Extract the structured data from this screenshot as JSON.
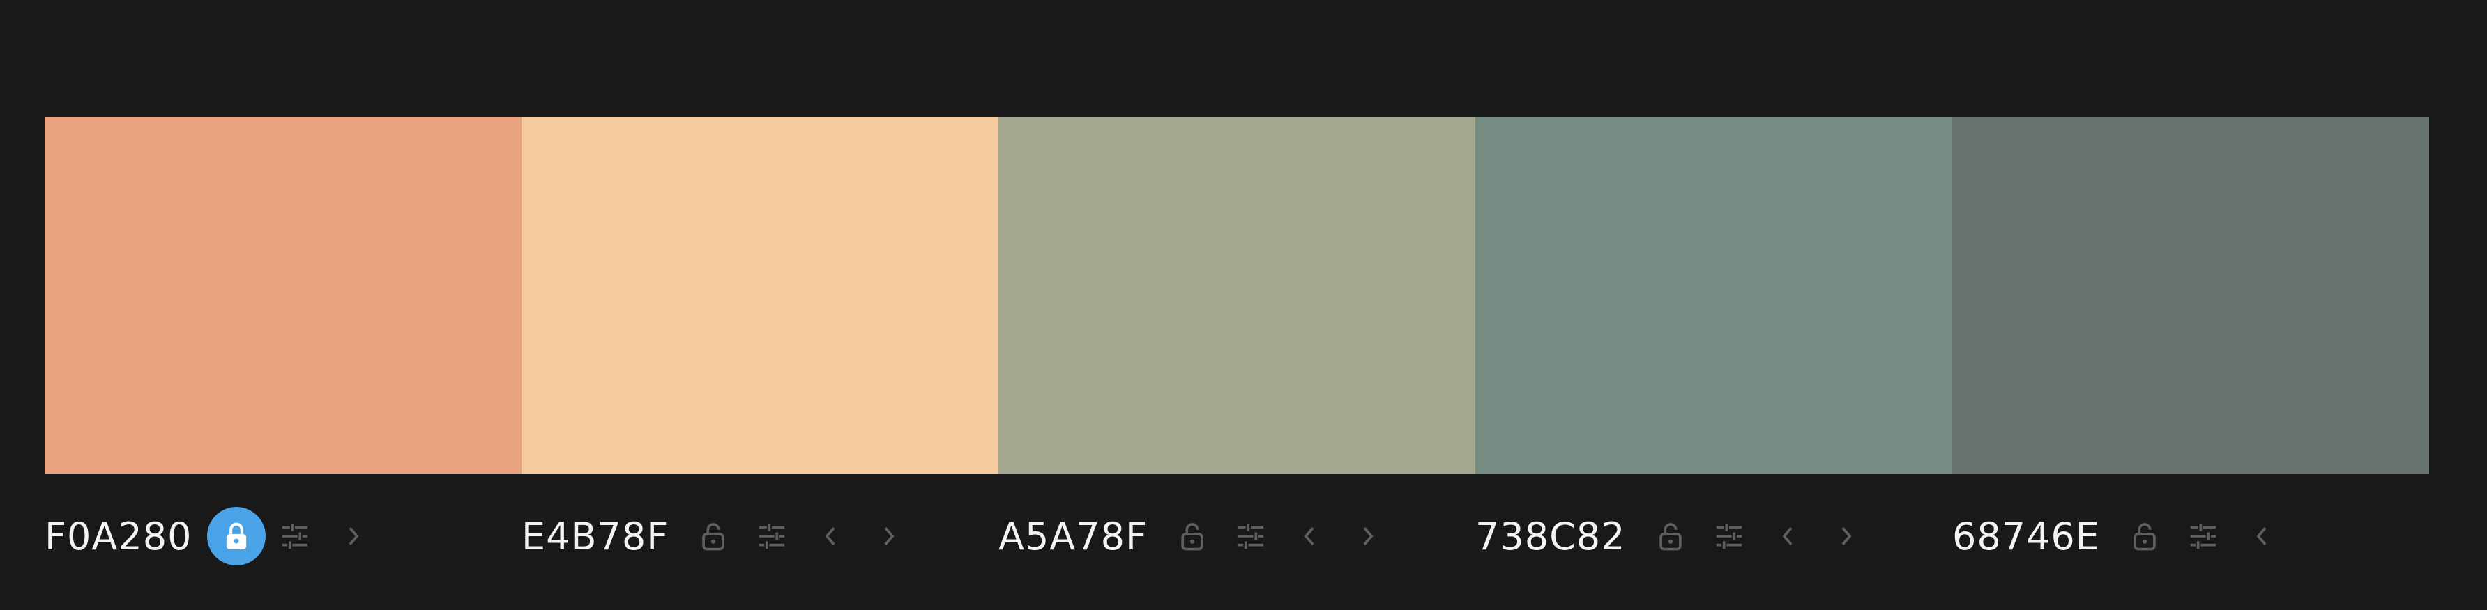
{
  "palette": {
    "colors": [
      {
        "hex": "F0A280",
        "swatch": "#eaa380",
        "locked": true,
        "has_prev": false,
        "has_next": true,
        "icons": [
          "lock-icon",
          "sliders-icon",
          "chevron-right-icon"
        ]
      },
      {
        "hex": "E4B78F",
        "swatch": "#f8cb9f",
        "locked": false,
        "has_prev": true,
        "has_next": true,
        "icons": [
          "lock-icon",
          "sliders-icon",
          "chevron-left-icon",
          "chevron-right-icon"
        ]
      },
      {
        "hex": "A5A78F",
        "swatch": "#a5a88f",
        "locked": false,
        "has_prev": true,
        "has_next": true,
        "icons": [
          "lock-icon",
          "sliders-icon",
          "chevron-left-icon",
          "chevron-right-icon"
        ]
      },
      {
        "hex": "738C82",
        "swatch": "#768d83",
        "locked": false,
        "has_prev": true,
        "has_next": true,
        "icons": [
          "lock-icon",
          "sliders-icon",
          "chevron-left-icon",
          "chevron-right-icon"
        ]
      },
      {
        "hex": "68746E",
        "swatch": "#69746e",
        "locked": false,
        "has_prev": true,
        "has_next": false,
        "icons": [
          "lock-icon",
          "sliders-icon",
          "chevron-left-icon"
        ]
      }
    ]
  },
  "theme": {
    "background": "#19191a",
    "label_text": "#f3f3f3",
    "icon_muted": "#5f5f60",
    "lock_active_bg": "#4aa3e6"
  }
}
